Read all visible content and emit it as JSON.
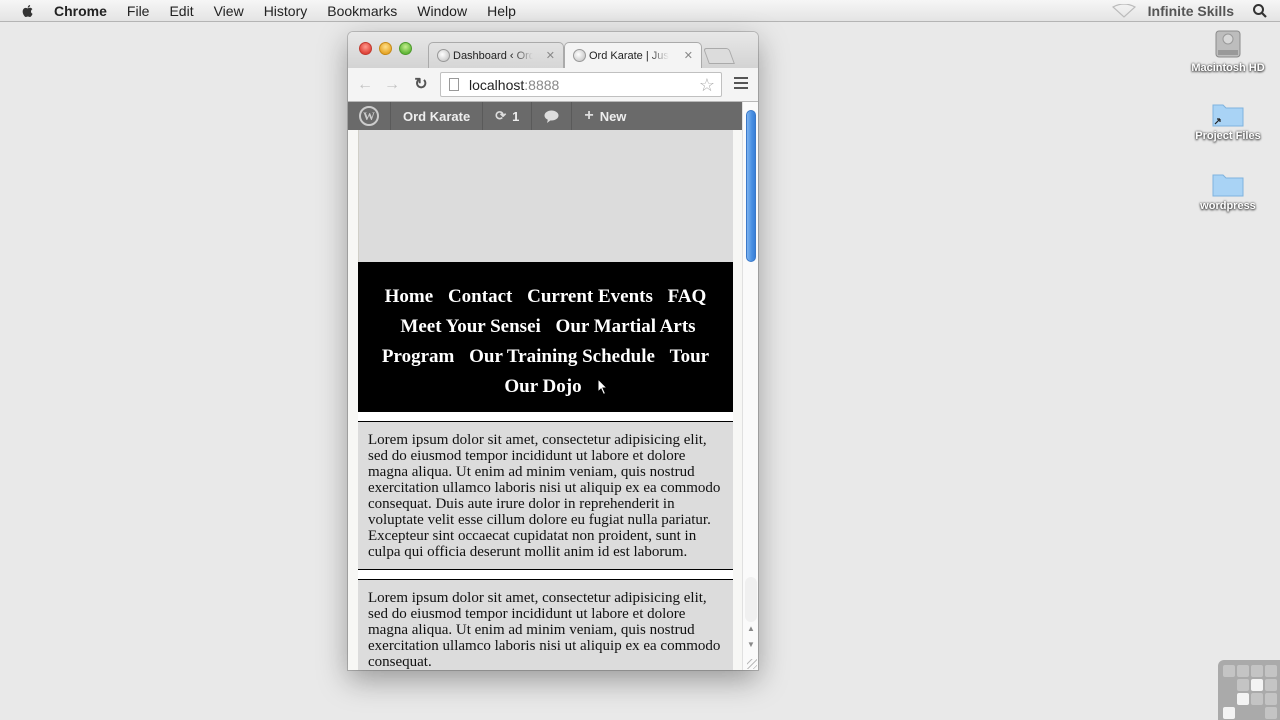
{
  "menubar": {
    "app": "Chrome",
    "items": [
      "File",
      "Edit",
      "View",
      "History",
      "Bookmarks",
      "Window",
      "Help"
    ],
    "user": "Infinite Skills"
  },
  "desktop": {
    "icons": [
      {
        "label": "Macintosh HD",
        "icon": "hard-drive-icon"
      },
      {
        "label": "Project Files",
        "icon": "folder-alias-icon"
      },
      {
        "label": "wordpress",
        "icon": "folder-icon"
      }
    ]
  },
  "browser": {
    "tabs": [
      {
        "title": "Dashboard ‹ Ord Karate",
        "active": false
      },
      {
        "title": "Ord Karate | Just another WordPress site",
        "active": true
      }
    ],
    "url": {
      "host": "localhost",
      "port": ":8888"
    }
  },
  "adminbar": {
    "site": "Ord Karate",
    "updates_count": "1",
    "new_label": "New"
  },
  "page": {
    "nav": [
      "Home",
      "Contact",
      "Current Events",
      "FAQ",
      "Meet Your Sensei",
      "Our Martial Arts Program",
      "Our Training Schedule",
      "Tour Our Dojo"
    ],
    "articles": [
      "Lorem ipsum dolor sit amet, consectetur adipisicing elit, sed do eiusmod tempor incididunt ut labore et dolore magna aliqua. Ut enim ad minim veniam, quis nostrud exercitation ullamco laboris nisi ut aliquip ex ea commodo consequat. Duis aute irure dolor in reprehenderit in voluptate velit esse cillum dolore eu fugiat nulla pariatur. Excepteur sint occaecat cupidatat non proident, sunt in culpa qui officia deserunt mollit anim id est laborum.",
      "Lorem ipsum dolor sit amet, consectetur adipisicing elit, sed do eiusmod tempor incididunt ut labore et dolore magna aliqua. Ut enim ad minim veniam, quis nostrud exercitation ullamco laboris nisi ut aliquip ex ea commodo consequat."
    ]
  },
  "colors": {
    "adminbar_bg": "#6a6a6a",
    "nav_bg": "#000000",
    "article_bg": "#dcdcdc",
    "scroll_thumb": "#4a90e2"
  }
}
